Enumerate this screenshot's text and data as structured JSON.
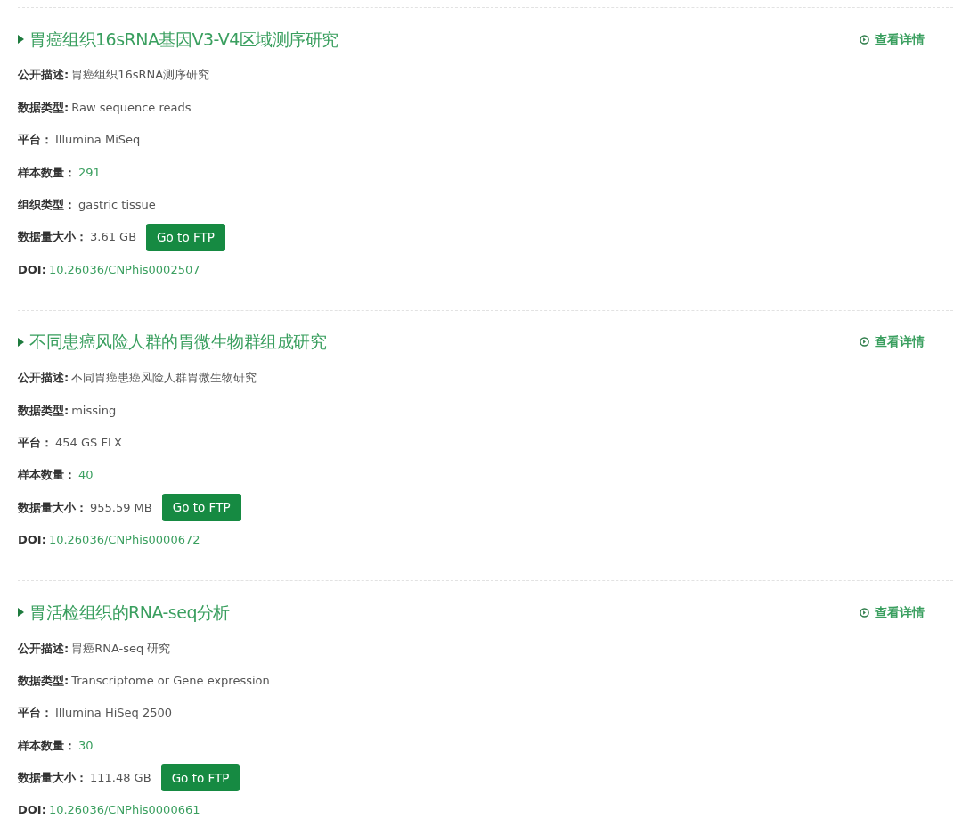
{
  "entries": [
    {
      "title": "胃癌组织16sRNA基因V3-V4区域测序研究",
      "detail_link": "查看详情",
      "fields": [
        {
          "kind": "text",
          "label": "公开描述:",
          "value": "胃癌组织16sRNA测序研究"
        },
        {
          "kind": "text",
          "label": "数据类型:",
          "value": "Raw sequence reads"
        },
        {
          "kind": "text",
          "label": "平台：",
          "value": "Illumina MiSeq"
        },
        {
          "kind": "count",
          "label": "样本数量：",
          "value": "291"
        },
        {
          "kind": "text",
          "label": "组织类型：",
          "value": "gastric tissue"
        },
        {
          "kind": "size",
          "label": "数据量大小：",
          "value": "3.61 GB",
          "button": "Go to FTP"
        },
        {
          "kind": "doi",
          "label": "DOI:",
          "value": "10.26036/CNPhis0002507"
        }
      ]
    },
    {
      "title": "不同患癌风险人群的胃微生物群组成研究",
      "detail_link": "查看详情",
      "fields": [
        {
          "kind": "text",
          "label": "公开描述:",
          "value": "不同胃癌患癌风险人群胃微生物研究"
        },
        {
          "kind": "text",
          "label": "数据类型:",
          "value": "missing"
        },
        {
          "kind": "text",
          "label": "平台：",
          "value": "454 GS FLX"
        },
        {
          "kind": "count",
          "label": "样本数量：",
          "value": "40"
        },
        {
          "kind": "size",
          "label": "数据量大小：",
          "value": "955.59 MB",
          "button": "Go to FTP"
        },
        {
          "kind": "doi",
          "label": "DOI:",
          "value": "10.26036/CNPhis0000672"
        }
      ]
    },
    {
      "title": "胃活检组织的RNA-seq分析",
      "detail_link": "查看详情",
      "fields": [
        {
          "kind": "text",
          "label": "公开描述:",
          "value": "胃癌RNA-seq 研究"
        },
        {
          "kind": "text",
          "label": "数据类型:",
          "value": "Transcriptome or Gene expression"
        },
        {
          "kind": "text",
          "label": "平台：",
          "value": "Illumina HiSeq 2500"
        },
        {
          "kind": "count",
          "label": "样本数量：",
          "value": "30"
        },
        {
          "kind": "size",
          "label": "数据量大小：",
          "value": "111.48 GB",
          "button": "Go to FTP"
        },
        {
          "kind": "doi",
          "label": "DOI:",
          "value": "10.26036/CNPhis0000661"
        }
      ]
    }
  ]
}
